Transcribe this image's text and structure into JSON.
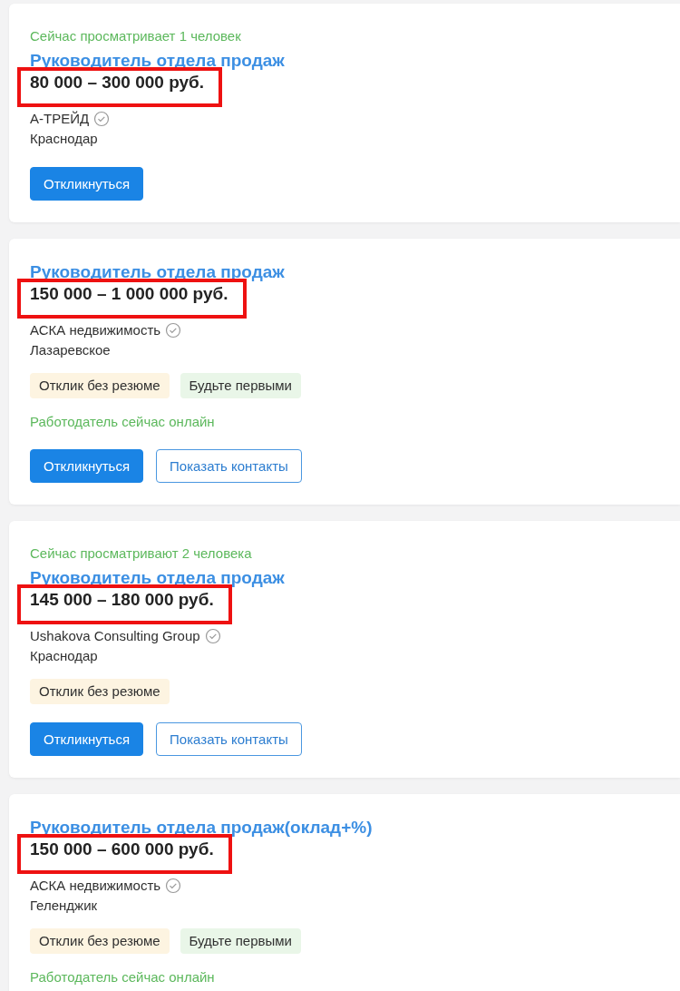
{
  "vacancies": [
    {
      "viewers": "Сейчас просматривает 1 человек",
      "title": "Руководитель отдела продаж",
      "salary": "80 000 – 300 000 руб.",
      "salary_highlighted": true,
      "company": "А-ТРЕЙД",
      "verified": true,
      "city": "Краснодар",
      "buttons": [
        {
          "label": "Откликнуться",
          "kind": "primary"
        }
      ]
    },
    {
      "title": "Руководитель отдела продаж",
      "salary": "150 000 – 1 000 000 руб.",
      "salary_highlighted": true,
      "company": "АСКА недвижимость",
      "verified": true,
      "city": "Лазаревское",
      "tags": [
        {
          "label": "Отклик без резюме",
          "color": "#fdf4e1"
        },
        {
          "label": "Будьте первыми",
          "color": "#e9f6e8"
        }
      ],
      "online": "Работодатель сейчас онлайн",
      "buttons": [
        {
          "label": "Откликнуться",
          "kind": "primary"
        },
        {
          "label": "Показать контакты",
          "kind": "outline"
        }
      ]
    },
    {
      "viewers": "Сейчас просматривают 2 человека",
      "title": "Руководитель отдела продаж",
      "salary": "145 000 – 180 000 руб.",
      "salary_highlighted": true,
      "company": "Ushakova Consulting Group",
      "verified": true,
      "city": "Краснодар",
      "tags": [
        {
          "label": "Отклик без резюме",
          "color": "#fdf4e1"
        }
      ],
      "buttons": [
        {
          "label": "Откликнуться",
          "kind": "primary"
        },
        {
          "label": "Показать контакты",
          "kind": "outline"
        }
      ]
    },
    {
      "title": "Руководитель отдела продаж(оклад+%)",
      "salary": "150 000 – 600 000 руб.",
      "salary_highlighted": true,
      "company": "АСКА недвижимость",
      "verified": true,
      "city": "Геленджик",
      "tags": [
        {
          "label": "Отклик без резюме",
          "color": "#fdf4e1"
        },
        {
          "label": "Будьте первыми",
          "color": "#e9f6e8"
        }
      ],
      "online": "Работодатель сейчас онлайн"
    }
  ]
}
